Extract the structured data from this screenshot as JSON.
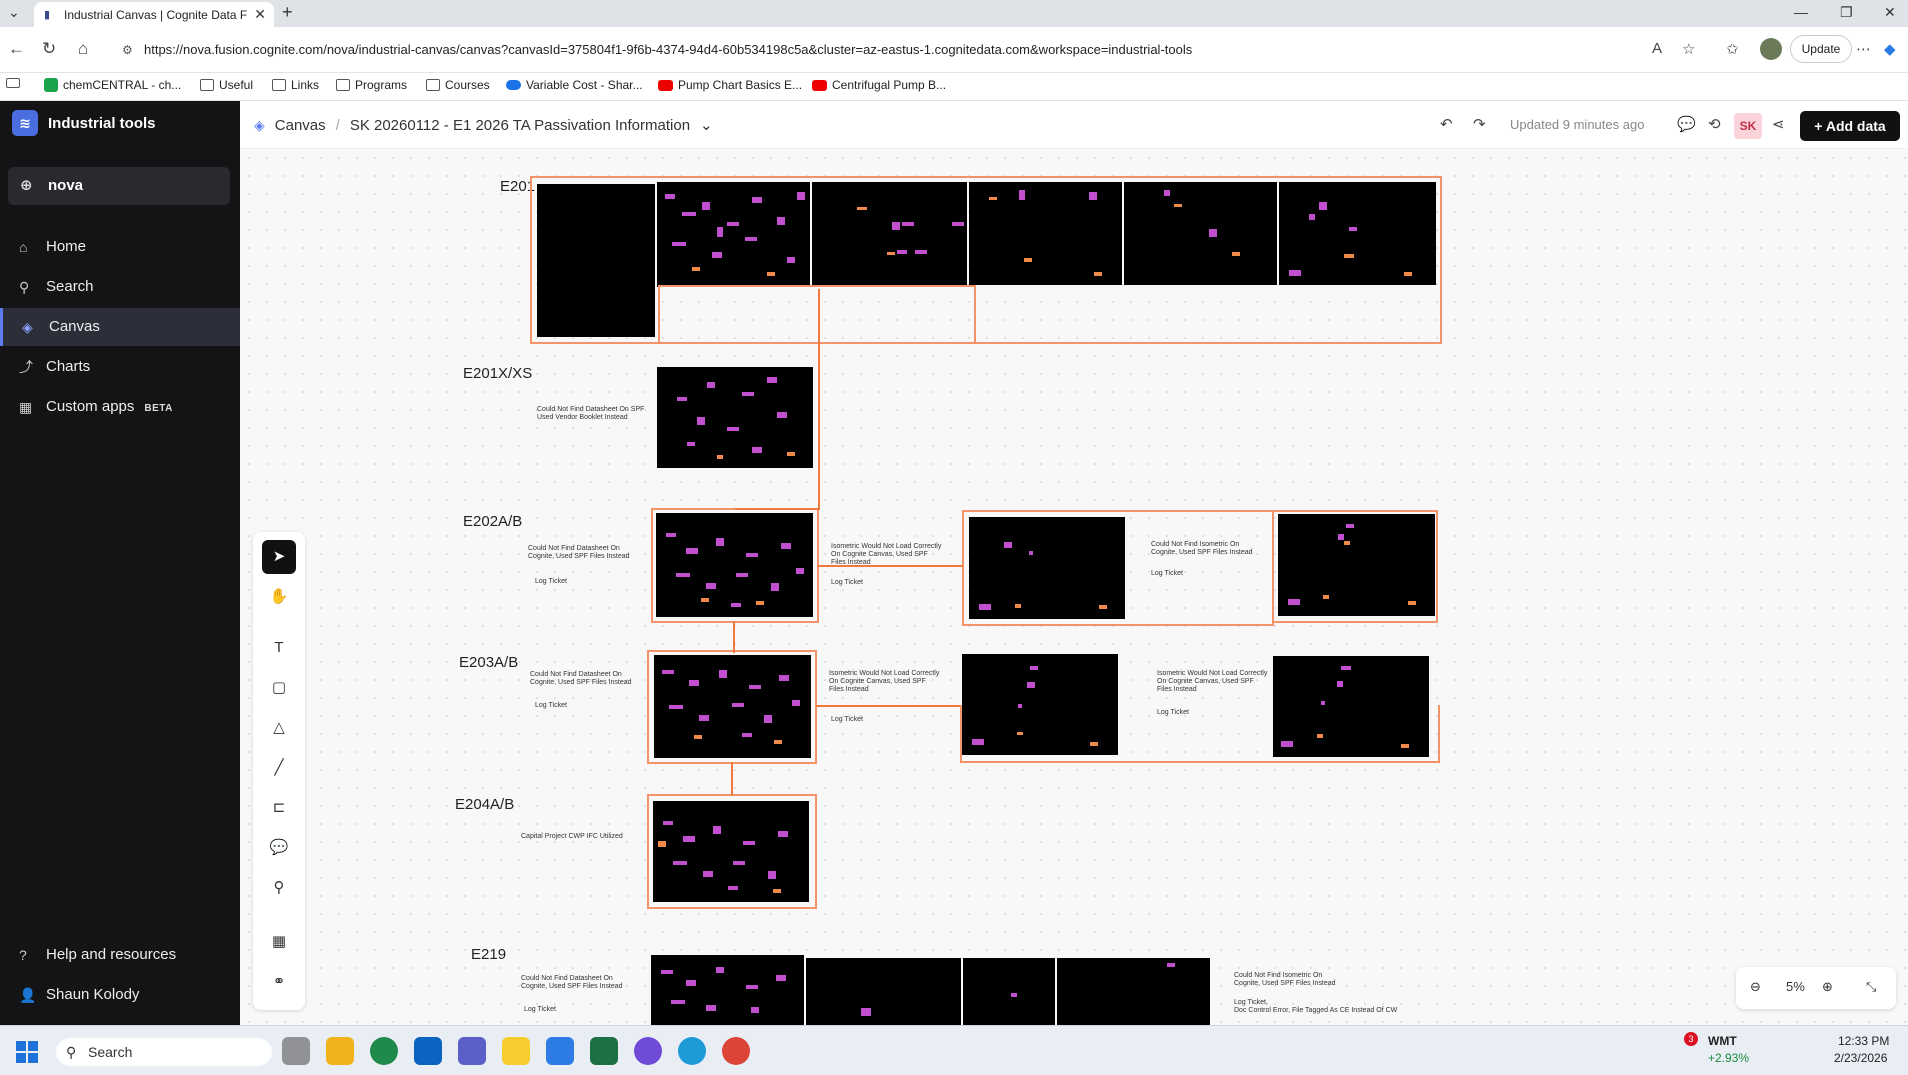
{
  "browser": {
    "tab_title": "Industrial Canvas | Cognite Data F",
    "url": "https://nova.fusion.cognite.com/nova/industrial-canvas/canvas?canvasId=375804f1-9f6b-4374-94d4-60b534198c5a&cluster=az-eastus-1.cognitedata.com&workspace=industrial-tools",
    "update_label": "Update",
    "bookmarks": [
      "chemCENTRAL - ch...",
      "Useful",
      "Links",
      "Programs",
      "Courses",
      "Variable Cost - Shar...",
      "Pump Chart Basics E...",
      "Centrifugal Pump B..."
    ]
  },
  "sidebar": {
    "app_name": "Industrial tools",
    "workspace": "nova",
    "items": [
      {
        "label": "Home",
        "icon": "home-icon"
      },
      {
        "label": "Search",
        "icon": "search-icon"
      },
      {
        "label": "Canvas",
        "icon": "canvas-icon",
        "active": true
      },
      {
        "label": "Charts",
        "icon": "charts-icon"
      },
      {
        "label": "Custom apps",
        "icon": "apps-icon",
        "badge": "BETA"
      }
    ],
    "help": "Help and resources",
    "user": "Shaun Kolody"
  },
  "topbar": {
    "crumb_root": "Canvas",
    "canvas_name": "SK 20260112 - E1 2026 TA Passivation Information",
    "updated": "Updated 9 minutes ago",
    "avatar_initials": "SK",
    "add_data": "Add data"
  },
  "canvas": {
    "labels": [
      "E201",
      "E201X/XS",
      "E202A/B",
      "E203A/B",
      "E204A/B",
      "E219"
    ],
    "notes": {
      "e201x": "Could Not Find Datasheet On SPF\nUsed Vendor Booklet Instead",
      "e202_ds": "Could Not Find Datasheet On\nCognite, Used SPF Files Instead",
      "e202_log": "Log Ticket",
      "e202_iso": "Isometric Would Not Load Correctly\nOn Cognite Canvas, Used SPF\nFiles Instead",
      "e202_iso_log": "Log Ticket",
      "e202_iso2": "Could Not Find Isometric On\nCognite, Used SPF Files Instead",
      "e202_iso2_log": "Log Ticket",
      "e203_ds": "Could Not Find Datasheet On\nCognite, Used SPF Files Instead",
      "e203_log": "Log Ticket",
      "e203_iso": "Isometric Would Not Load Correctly\nOn Cognite Canvas, Used SPF\nFiles Instead",
      "e203_iso_log": "Log Ticket",
      "e203_iso2": "Isometric Would Not Load Correctly\nOn Cognite Canvas, Used SPF\nFiles Instead",
      "e203_iso2_log": "Log Ticket",
      "e204": "Capital Project CWP IFC Utilized",
      "e219_ds": "Could Not Find Datasheet On\nCognite, Used SPF Files Instead",
      "e219_log": "Log Ticket",
      "e219_iso": "Could Not Find Isometric On\nCognite, Used SPF Files Instead",
      "e219_err": "Log Ticket,\nDoc Control Error, File Tagged As CE Instead Of CW"
    }
  },
  "zoom": {
    "level": "5%"
  },
  "taskbar": {
    "search": "Search",
    "stock": "WMT",
    "stock_change": "+2.93%",
    "time": "12:33 PM",
    "date": "2/23/2026",
    "notif_count": "3"
  }
}
